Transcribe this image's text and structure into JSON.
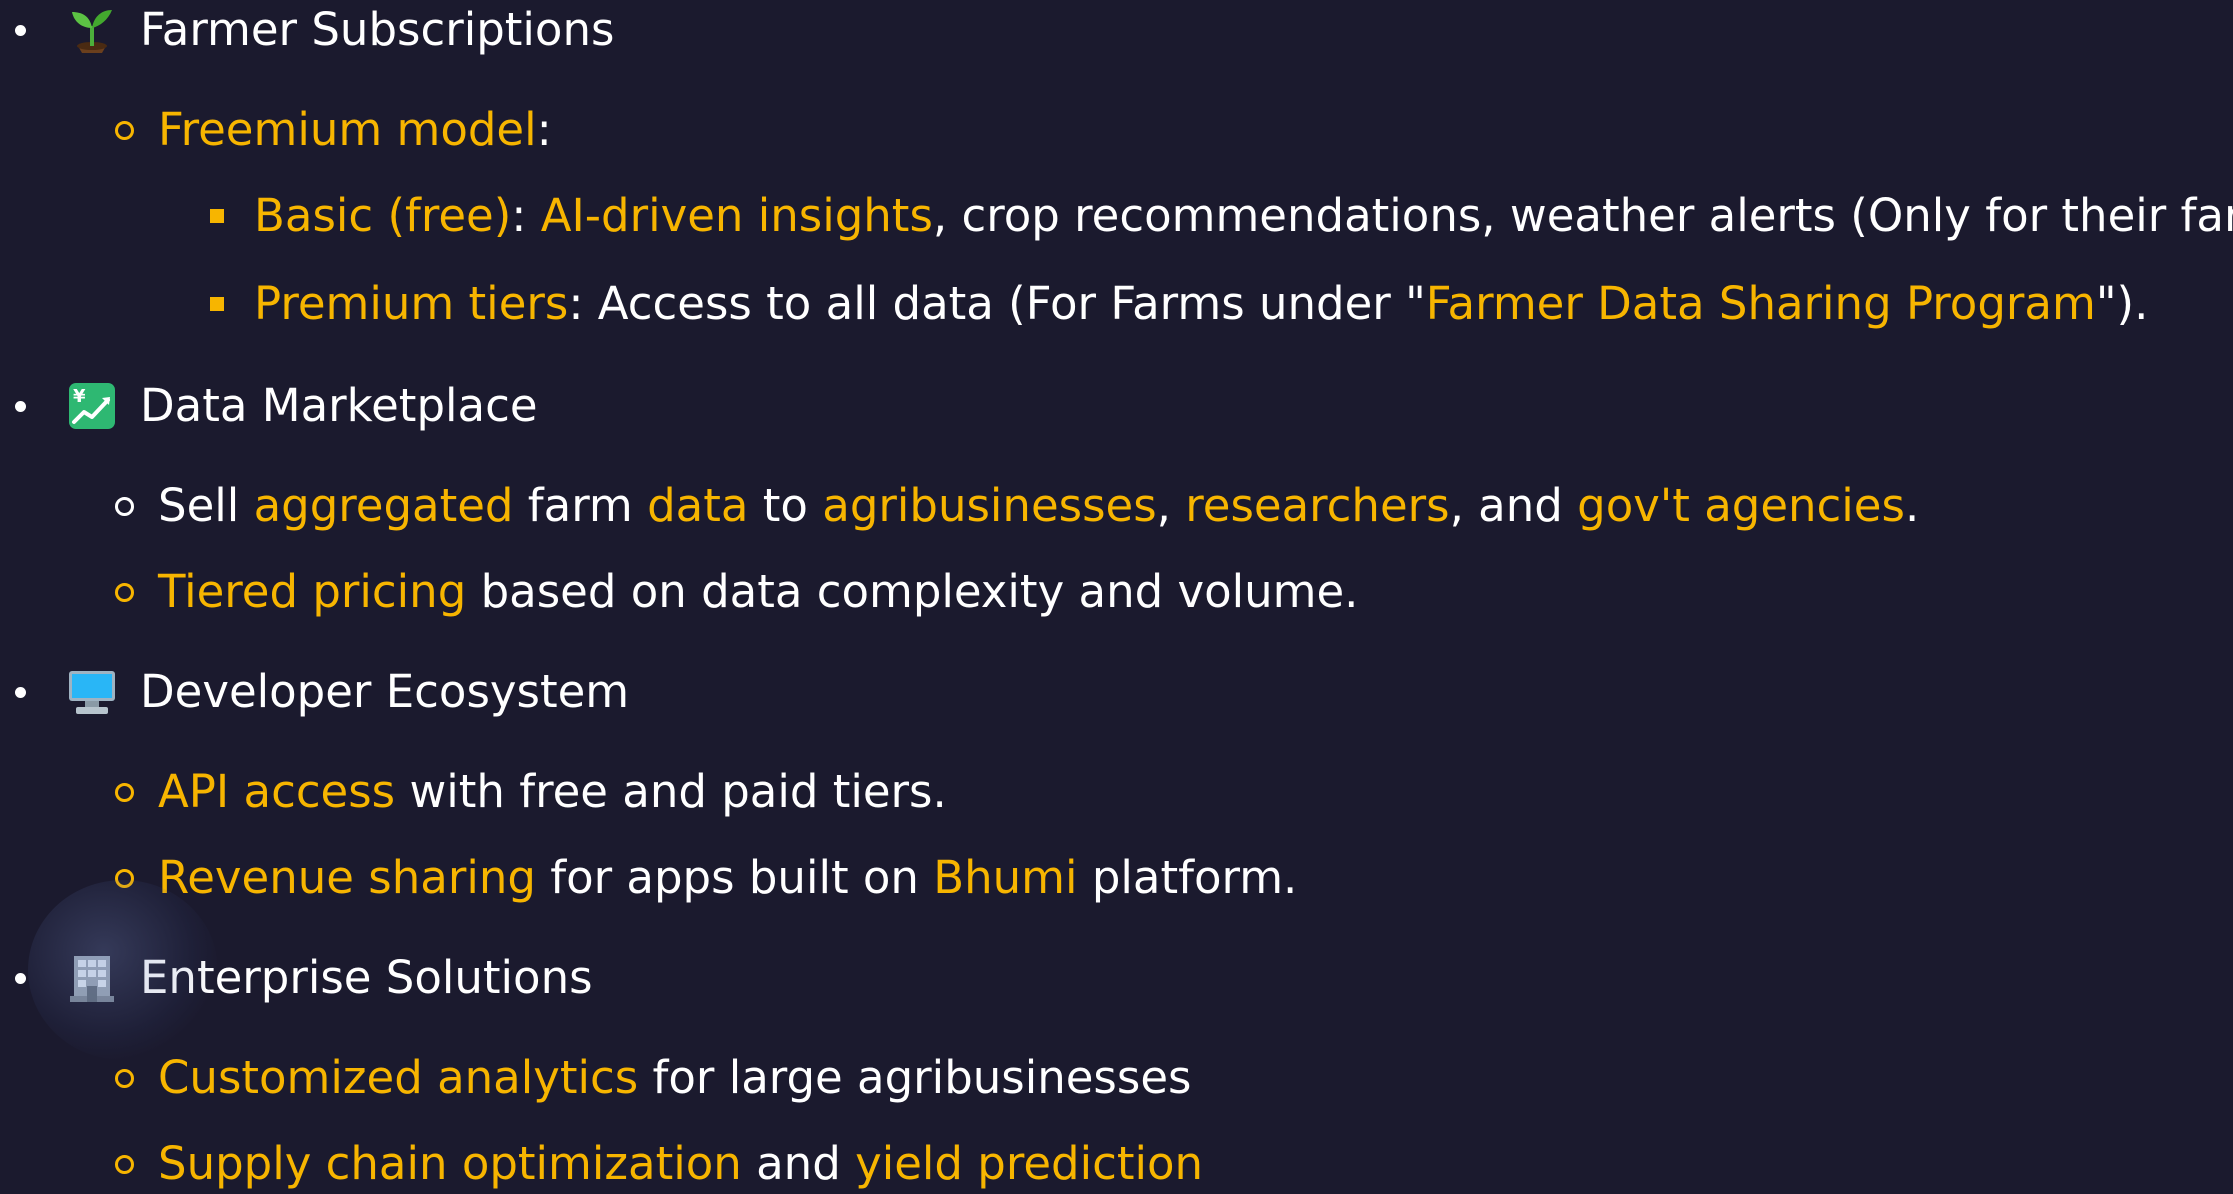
{
  "sections": [
    {
      "icon": "seedling-icon",
      "title": "Farmer Subscriptions",
      "items": [
        {
          "parts": [
            {
              "t": "Freemium model",
              "hl": true
            },
            {
              "t": ":",
              "hl": false
            }
          ],
          "subitems": [
            {
              "parts": [
                {
                  "t": "Basic (free)",
                  "hl": true
                },
                {
                  "t": ": ",
                  "hl": false
                },
                {
                  "t": "AI-driven insights",
                  "hl": true
                },
                {
                  "t": ", crop recommendations, weather alerts (Only for their farm).",
                  "hl": false
                }
              ]
            },
            {
              "parts": [
                {
                  "t": "Premium tiers",
                  "hl": true
                },
                {
                  "t": ": Access to all data (For Farms under \"",
                  "hl": false
                },
                {
                  "t": "Farmer Data Sharing Program",
                  "hl": true
                },
                {
                  "t": "\").",
                  "hl": false
                }
              ]
            }
          ]
        }
      ]
    },
    {
      "icon": "yen-chart-icon",
      "title": "Data Marketplace",
      "items": [
        {
          "parts": [
            {
              "t": "Sell ",
              "hl": false
            },
            {
              "t": "aggregated",
              "hl": true
            },
            {
              "t": " farm ",
              "hl": false
            },
            {
              "t": "data",
              "hl": true
            },
            {
              "t": " to ",
              "hl": false
            },
            {
              "t": "agribusinesses",
              "hl": true
            },
            {
              "t": ", ",
              "hl": false
            },
            {
              "t": "researchers",
              "hl": true
            },
            {
              "t": ", and ",
              "hl": false
            },
            {
              "t": "gov't agencies",
              "hl": true
            },
            {
              "t": ".",
              "hl": false
            }
          ]
        },
        {
          "parts": [
            {
              "t": "Tiered pricing",
              "hl": true
            },
            {
              "t": " based on data complexity and volume.",
              "hl": false
            }
          ]
        }
      ]
    },
    {
      "icon": "desktop-computer-icon",
      "title": "Developer Ecosystem",
      "items": [
        {
          "parts": [
            {
              "t": "API access",
              "hl": true
            },
            {
              "t": " with free and paid tiers.",
              "hl": false
            }
          ]
        },
        {
          "parts": [
            {
              "t": "Revenue sharing",
              "hl": true
            },
            {
              "t": " for apps built on ",
              "hl": false
            },
            {
              "t": "Bhumi",
              "hl": true
            },
            {
              "t": " platform.",
              "hl": false
            }
          ]
        }
      ]
    },
    {
      "icon": "office-building-icon",
      "title": "Enterprise Solutions",
      "items": [
        {
          "parts": [
            {
              "t": "Customized analytics",
              "hl": true
            },
            {
              "t": " for large agribusinesses",
              "hl": false
            }
          ]
        },
        {
          "parts": [
            {
              "t": "Supply chain optimization",
              "hl": true
            },
            {
              "t": " and ",
              "hl": false
            },
            {
              "t": "yield prediction",
              "hl": true
            }
          ]
        }
      ]
    }
  ],
  "colors": {
    "background": "#1b1a2e",
    "text": "#ffffff",
    "highlight": "#f7b500"
  }
}
